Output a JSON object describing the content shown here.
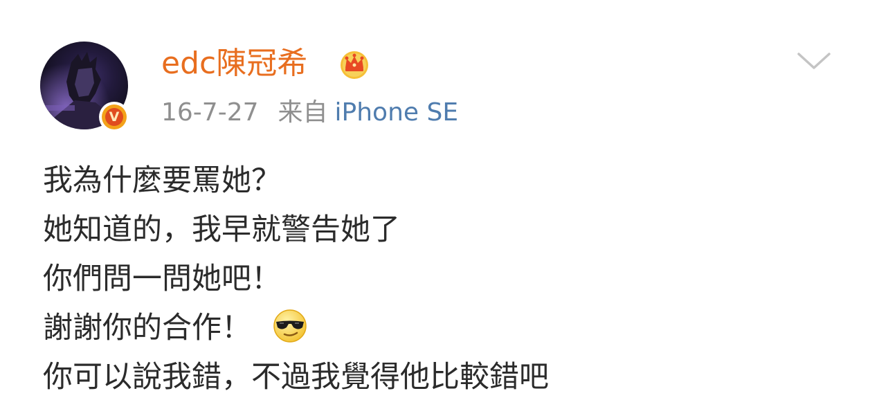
{
  "post": {
    "author": {
      "name": "edc陳冠希",
      "avatar_icon": "avatar-figure",
      "verified_badge": "V",
      "crown_icon": "crown-icon"
    },
    "meta": {
      "date": "16-7-27",
      "from_label": "来自",
      "source": "iPhone SE"
    },
    "menu_icon": "chevron-down-icon",
    "lines": [
      "我為什麼要罵她？",
      "她知道的，我早就警告她了",
      "你們問一問她吧！",
      "謝謝你的合作！",
      "你可以說我錯，不過我覺得他比較錯吧"
    ],
    "emoji": "cool-sunglasses-emoji",
    "colors": {
      "username": "#e86e1f",
      "meta_gray": "#8f8f8f",
      "source_link": "#4f7cae",
      "body_text": "#2b2b2b"
    }
  }
}
